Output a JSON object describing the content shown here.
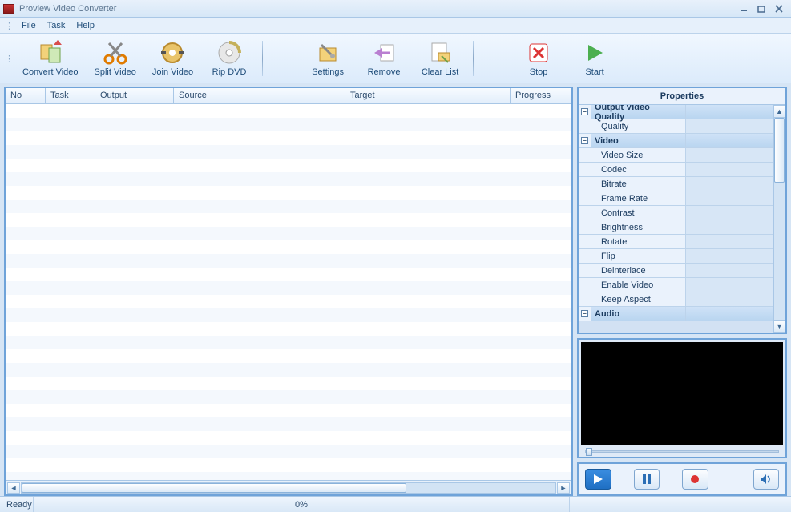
{
  "window": {
    "title": "Proview Video Converter"
  },
  "menu": {
    "file": "File",
    "task": "Task",
    "help": "Help"
  },
  "toolbar": {
    "convert": "Convert Video",
    "split": "Split Video",
    "join": "Join Video",
    "rip": "Rip DVD",
    "settings": "Settings",
    "remove": "Remove",
    "clear": "Clear List",
    "stop": "Stop",
    "start": "Start"
  },
  "grid": {
    "columns": {
      "no": "No",
      "task": "Task",
      "output": "Output",
      "source": "Source",
      "target": "Target",
      "progress": "Progress"
    }
  },
  "properties": {
    "title": "Properties",
    "groups": {
      "output_quality": "Output Video Quality",
      "video": "Video",
      "audio": "Audio"
    },
    "items": {
      "quality": "Quality",
      "video_size": "Video Size",
      "codec": "Codec",
      "bitrate": "Bitrate",
      "frame_rate": "Frame Rate",
      "contrast": "Contrast",
      "brightness": "Brightness",
      "rotate": "Rotate",
      "flip": "Flip",
      "deinterlace": "Deinterlace",
      "enable_video": "Enable Video",
      "keep_aspect": "Keep Aspect"
    }
  },
  "status": {
    "ready": "Ready",
    "progress": "0%"
  },
  "icons": {
    "minimize": "minimize-icon",
    "maximize": "maximize-icon",
    "close": "close-icon"
  }
}
